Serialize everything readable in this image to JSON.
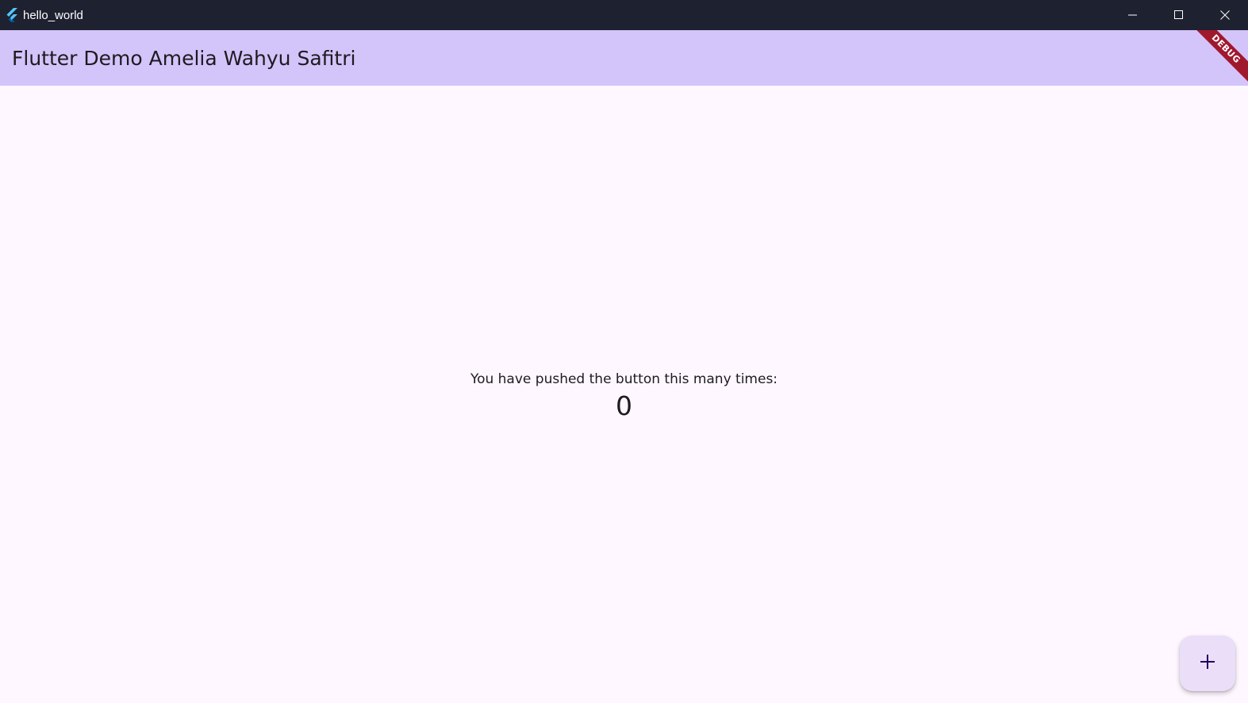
{
  "window": {
    "title": "hello_world",
    "icons": {
      "app": "flutter-logo-icon",
      "minimize": "minimize-icon",
      "maximize": "maximize-icon",
      "close": "close-icon"
    }
  },
  "appbar": {
    "title": "Flutter Demo Amelia Wahyu Safitri"
  },
  "debug_banner": {
    "label": "DEBUG",
    "color": "#a0182e"
  },
  "body": {
    "message": "You have pushed the button this many times:",
    "counter": "0"
  },
  "fab": {
    "icon": "add-icon"
  },
  "colors": {
    "titlebar_bg": "#1e2130",
    "appbar_bg": "#d3c4f9",
    "page_bg": "#fef7ff",
    "fab_bg": "#ebdef9",
    "text": "#1d1b20"
  }
}
